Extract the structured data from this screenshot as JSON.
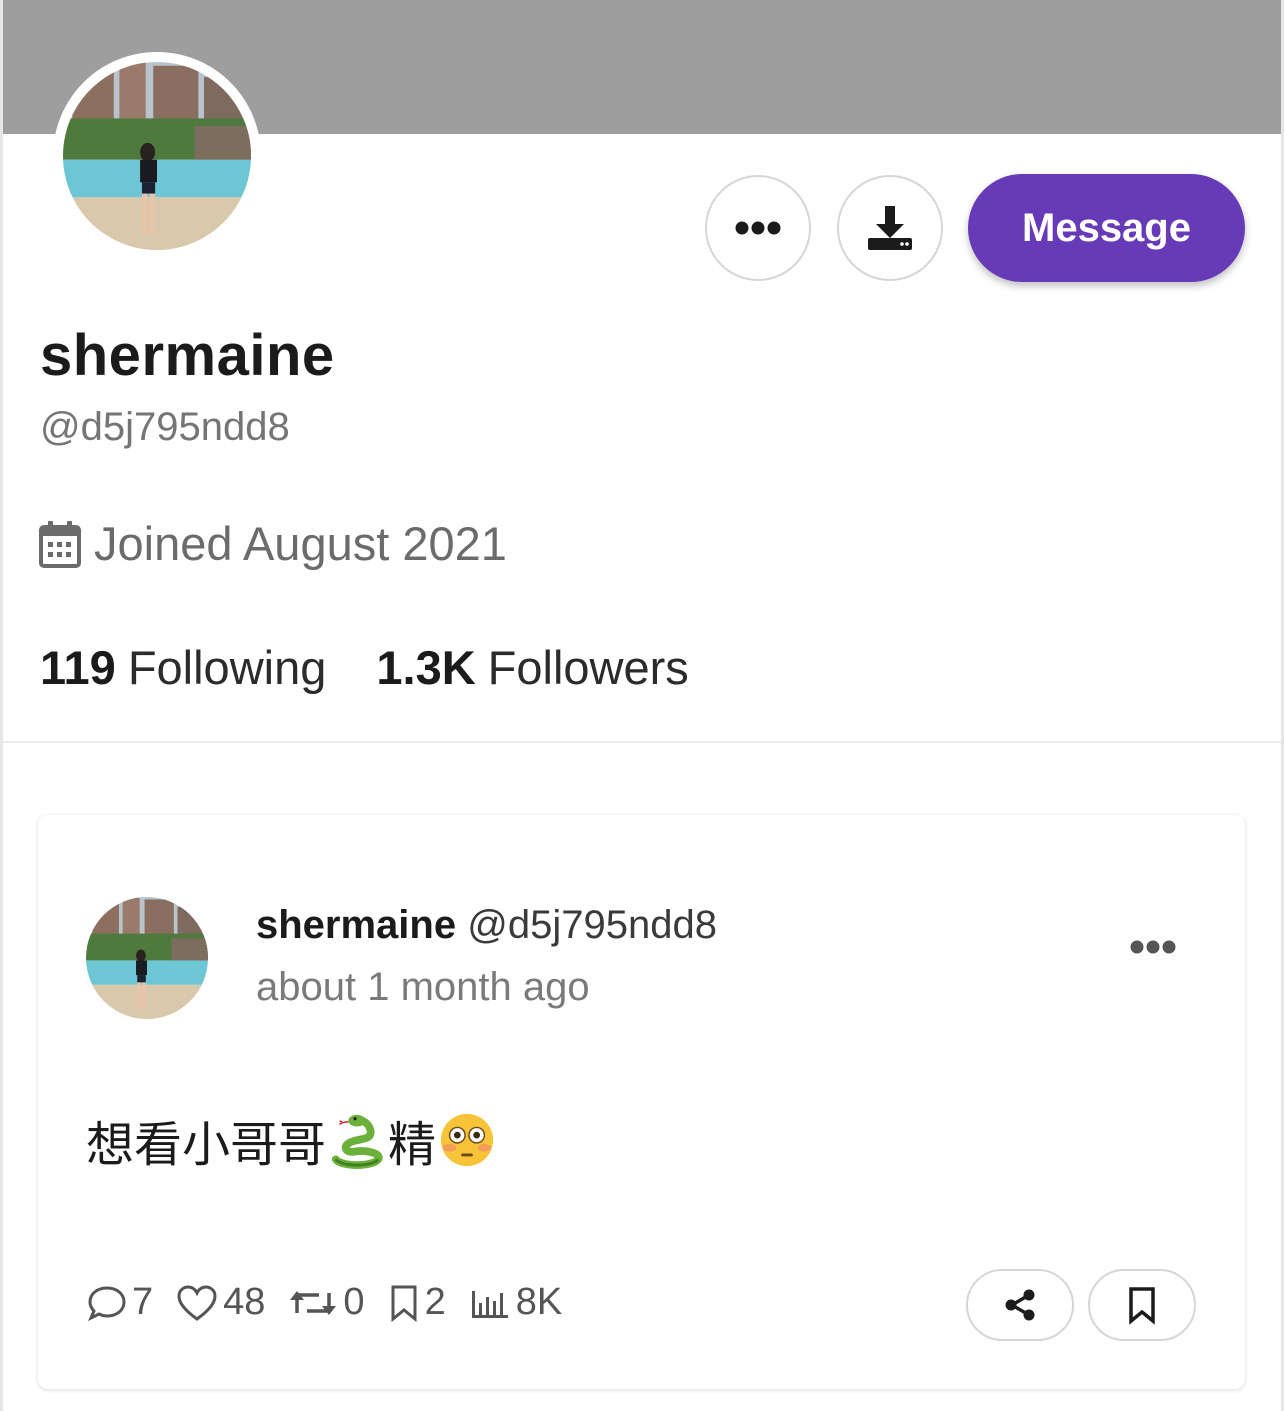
{
  "profile": {
    "display_name": "shermaine",
    "handle": "@d5j795ndd8",
    "joined": "Joined August 2021",
    "following_count": "119",
    "following_label": "Following",
    "followers_count": "1.3K",
    "followers_label": "Followers",
    "banner_color": "#9e9e9e"
  },
  "actions": {
    "message_label": "Message",
    "accent_color": "#673ab7",
    "more_icon": "more-horizontal-icon",
    "download_icon": "download-icon"
  },
  "post": {
    "author_name": "shermaine",
    "author_handle": "@d5j795ndd8",
    "time": "about 1 month ago",
    "text_part1": "想看小哥哥",
    "text_part2": "精",
    "emojis": [
      "snake",
      "flushed-face"
    ],
    "stats": {
      "comments": "7",
      "likes": "48",
      "reposts": "0",
      "bookmarks": "2",
      "views": "8K"
    }
  }
}
